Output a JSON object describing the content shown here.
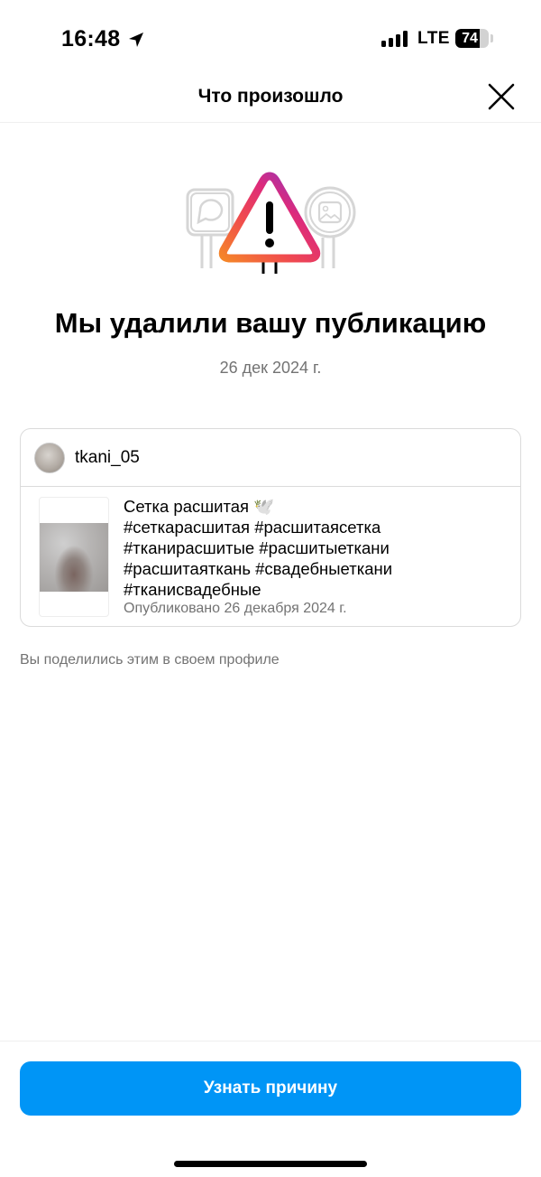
{
  "status_bar": {
    "time": "16:48",
    "network": "LTE",
    "battery_percent": "74",
    "battery_level": 0.74,
    "location_icon": "location-arrow-icon",
    "signal_bars": 4
  },
  "nav": {
    "title": "Что произошло",
    "close_icon": "close-icon"
  },
  "hero": {
    "icon": "warning-triangle-icon",
    "gradient_colors": [
      "#f58529",
      "#dd2a7b",
      "#8134af",
      "#515bd4"
    ]
  },
  "headline": "Мы удалили вашу публикацию",
  "date": "26 дек 2024 г.",
  "post": {
    "username": "tkani_05",
    "caption_lines": [
      "Сетка расшитая 🕊️",
      "#сеткарасшитая #расшитаясетка",
      "#тканирасшитые #расшитыеткани",
      "#расшитаяткань #свадебныеткани",
      "#тканисвадебные"
    ],
    "published": "Опубликовано 26 декабря 2024 г."
  },
  "note": "Вы поделились этим в своем профиле",
  "cta_label": "Узнать причину",
  "colors": {
    "accent": "#0095f6",
    "secondary_text": "#737373",
    "border": "#dbdbdb"
  }
}
